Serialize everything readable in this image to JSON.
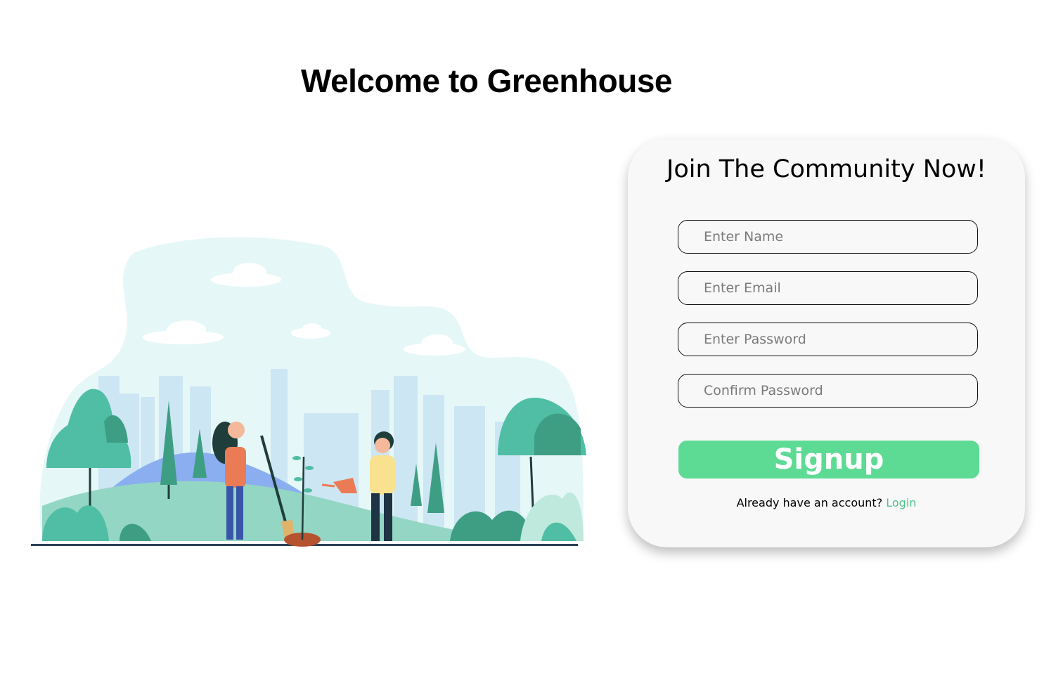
{
  "header": {
    "title": "Welcome to Greenhouse"
  },
  "signup_card": {
    "title": "Join The Community Now!",
    "fields": {
      "name": {
        "placeholder": "Enter Name",
        "value": ""
      },
      "email": {
        "placeholder": "Enter Email",
        "value": ""
      },
      "password": {
        "placeholder": "Enter Password",
        "value": ""
      },
      "confirm_password": {
        "placeholder": "Confirm Password",
        "value": ""
      }
    },
    "submit_label": "Signup",
    "login_prompt": "Already have an account?",
    "login_link": "Login"
  },
  "illustration": {
    "subject": "gardening-illustration",
    "colors": {
      "sky": "#e6f7f8",
      "buildings": "#cde6f4",
      "hill_blue": "#8aaef0",
      "hill_green": "#93d6c4",
      "tree": "#4fbea4",
      "accent_orange": "#ea7b54"
    }
  },
  "colors": {
    "accent": "#5ddb94",
    "link": "#4fc28a",
    "card_bg": "#f9f8f9"
  }
}
